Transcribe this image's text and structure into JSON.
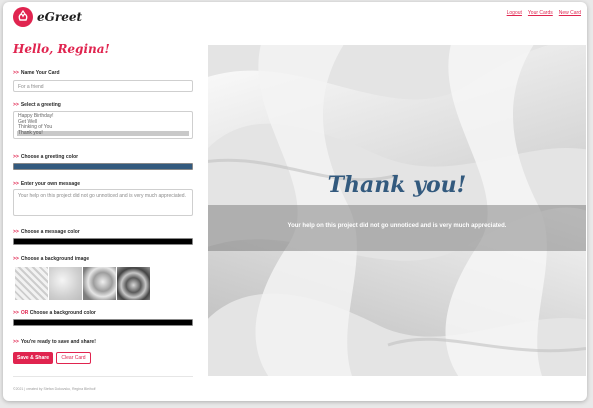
{
  "app": {
    "name": "eGreet",
    "brand_color": "#e0244f"
  },
  "nav": {
    "logout": "Logout",
    "your_cards": "Your Cards",
    "new_card": "New Card"
  },
  "sidebar": {
    "greeting": "Hello, Regina!",
    "name_label": "Name Your Card",
    "name_placeholder": "For a friend",
    "select_label": "Select a greeting",
    "greetings": [
      "Happy Birthday!",
      "Get Well",
      "Thinking of You",
      "Thank you!"
    ],
    "selected_greeting": "Thank you!",
    "greeting_color_label": "Choose a greeting color",
    "greeting_color": "#335a7e",
    "message_label": "Enter your own message",
    "message_value": "Your help on this project did not go unnoticed and is very much appreciated.",
    "message_color_label": "Choose a message color",
    "message_color": "#000000",
    "bg_image_label": "Choose a background image",
    "or_word": "OR",
    "bg_color_label": "Choose a background color",
    "bg_color": "#000000",
    "ready_label": "You're ready to save and share!",
    "save_button": "Save & Share",
    "clear_button": "Clear Card",
    "footer": "©2021 | created by Stefan Dokovsko, Regina Bleiholf"
  },
  "card": {
    "title": "Thank you!",
    "message": "Your help on this project did not go unnoticed and is very much appreciated.",
    "title_color": "#335a7e",
    "message_color": "#ffffff"
  },
  "arrow": ">>"
}
